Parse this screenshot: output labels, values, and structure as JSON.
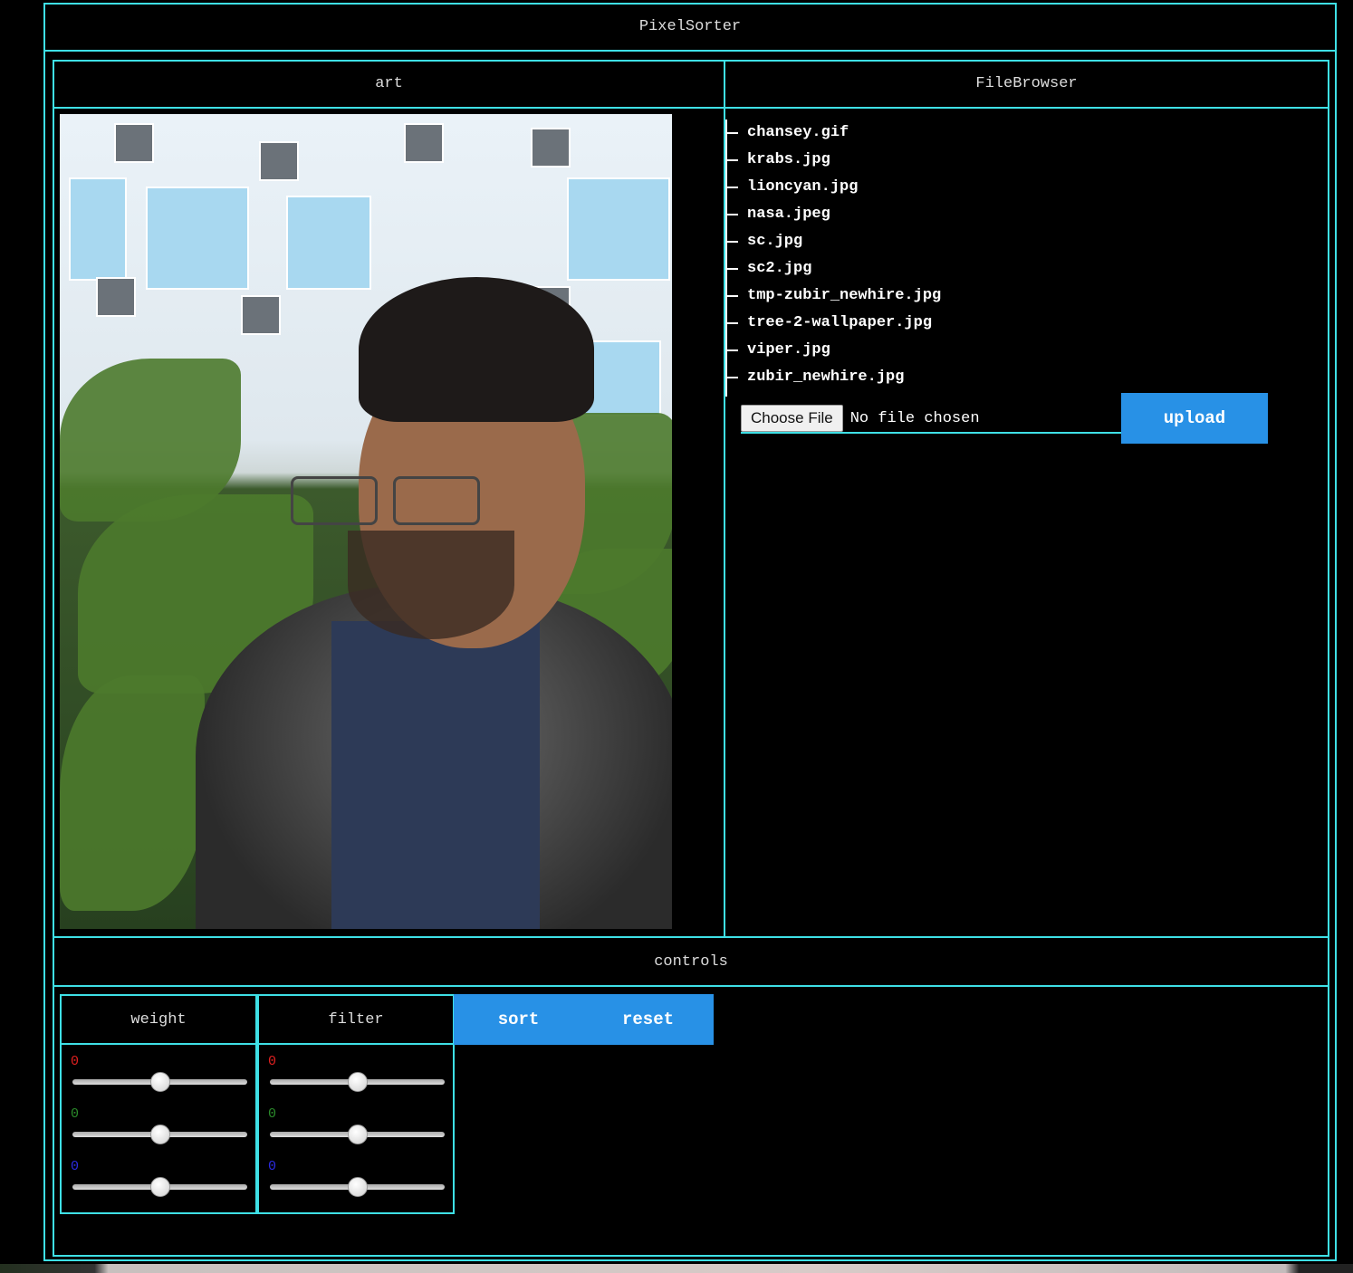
{
  "app": {
    "title": "PixelSorter"
  },
  "art": {
    "header": "art"
  },
  "file_browser": {
    "header": "FileBrowser",
    "files": [
      "chansey.gif",
      "krabs.jpg",
      "lioncyan.jpg",
      "nasa.jpeg",
      "sc.jpg",
      "sc2.jpg",
      "tmp-zubir_newhire.jpg",
      "tree-2-wallpaper.jpg",
      "viper.jpg",
      "zubir_newhire.jpg"
    ],
    "choose_file_label": "Choose File",
    "no_file_label": "No file chosen",
    "upload_label": "upload"
  },
  "controls": {
    "header": "controls",
    "weight": {
      "label": "weight",
      "r": "0",
      "g": "0",
      "b": "0"
    },
    "filter": {
      "label": "filter",
      "r": "0",
      "g": "0",
      "b": "0"
    },
    "sort_label": "sort",
    "reset_label": "reset"
  },
  "colors": {
    "accent_border": "#3ee0e6",
    "button_blue": "#2891e6",
    "background": "#000000"
  }
}
